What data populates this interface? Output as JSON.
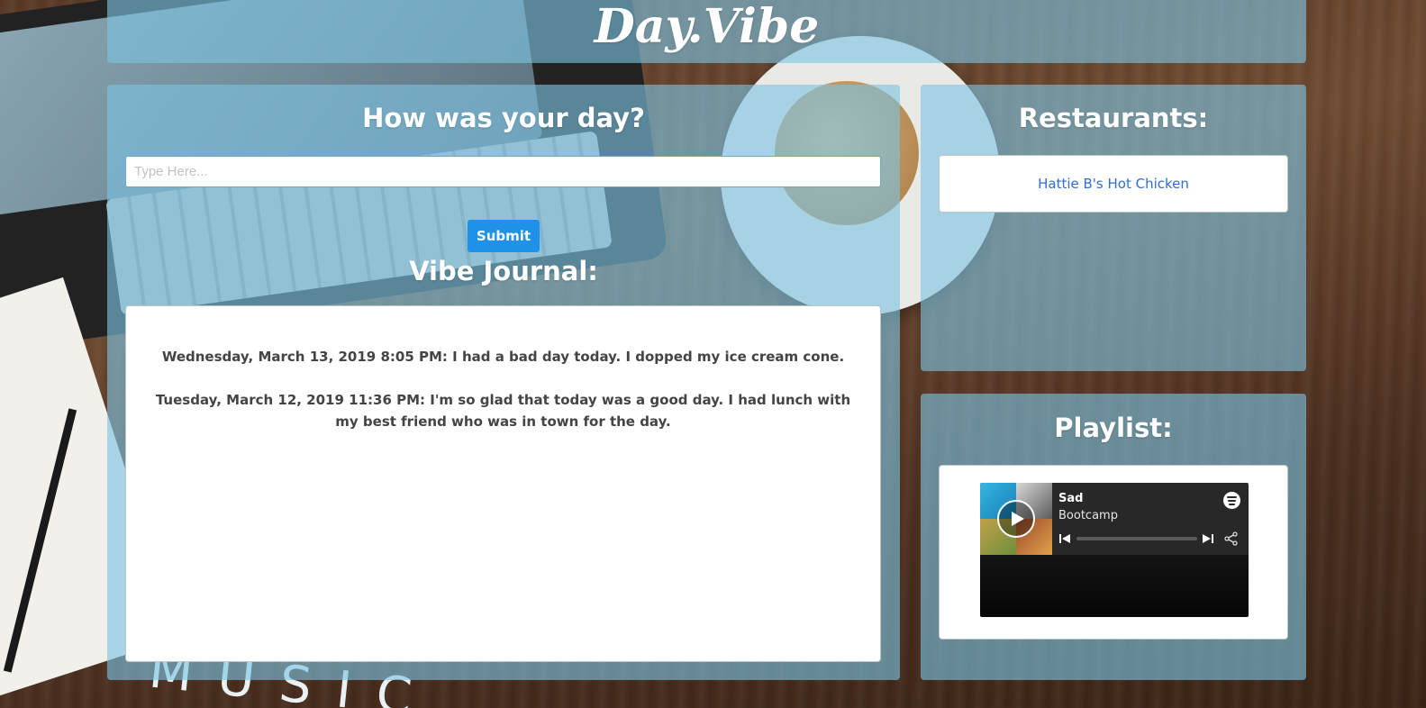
{
  "header": {
    "brand": "Day.Vibe"
  },
  "day_panel": {
    "heading": "How was your day?",
    "input": {
      "placeholder": "Type Here...",
      "value": ""
    },
    "submit_label": "Submit",
    "journal_heading": "Vibe Journal:",
    "entries": [
      {
        "text": "Wednesday, March 13, 2019 8:05 PM: I had a bad day today. I dopped my ice cream cone."
      },
      {
        "text": "Tuesday, March 12, 2019 11:36 PM: I'm so glad that today was a good day. I had lunch with my best friend who was in town for the day."
      }
    ]
  },
  "restaurants_panel": {
    "heading": "Restaurants:",
    "items": [
      {
        "name": "Hattie B's Hot Chicken"
      }
    ]
  },
  "playlist_panel": {
    "heading": "Playlist:",
    "player": {
      "title": "Sad",
      "subtitle": "Bootcamp",
      "icons": [
        "play-icon",
        "spotify-icon",
        "previous-icon",
        "next-icon",
        "share-icon"
      ]
    }
  },
  "colors": {
    "panel_overlay": "#7cc4e2",
    "submit_button": "#1f91e8",
    "link": "#2f6fcf",
    "player_bg": "#282828"
  }
}
